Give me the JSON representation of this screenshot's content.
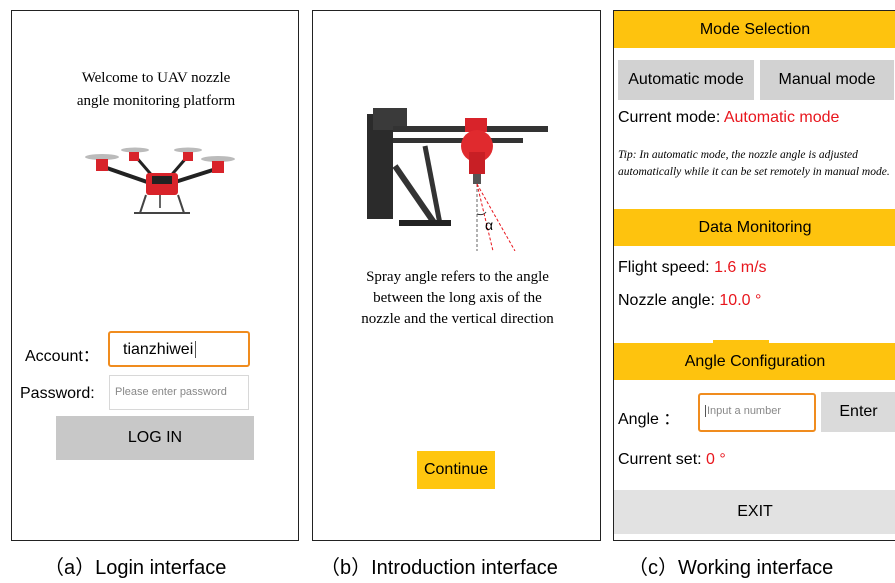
{
  "login": {
    "welcome_line1": "Welcome to UAV nozzle",
    "welcome_line2": "angle monitoring platform",
    "account_label": "Account：",
    "account_value": "tianzhiwei",
    "password_label": "Password:",
    "password_placeholder": "Please enter password",
    "login_button": "LOG IN",
    "caption": "（a）Login interface"
  },
  "intro": {
    "angle_symbol": "α",
    "line1": "Spray angle refers to the angle",
    "line2": "between the long axis of the",
    "line3": "nozzle and the vertical direction",
    "continue_button": "Continue",
    "caption": "（b）Introduction interface"
  },
  "working": {
    "mode_header": "Mode Selection",
    "automatic_button": "Automatic mode",
    "manual_button": "Manual mode",
    "current_mode_label": "Current mode: ",
    "current_mode_value": "Automatic mode",
    "tip": "Tip: In automatic mode, the nozzle angle is adjusted automatically while it can be set remotely in manual mode.",
    "data_header": "Data Monitoring",
    "flight_speed_label": "Flight  speed: ",
    "flight_speed_value": "1.6 m/s",
    "nozzle_angle_label": "Nozzle angle:  ",
    "nozzle_angle_value": "10.0 °",
    "config_header": "Angle Configuration",
    "angle_label": "Angle ：",
    "angle_placeholder": "Input a number",
    "enter_button": "Enter",
    "current_set_label": "Current set: ",
    "current_set_value": "0 °",
    "exit_button": "EXIT",
    "caption": "（c）Working interface"
  },
  "colors": {
    "accent_yellow": "#fec30e",
    "input_border_orange": "#f08c1e",
    "value_red": "#e8161d",
    "button_gray": "#d2d2d2"
  }
}
